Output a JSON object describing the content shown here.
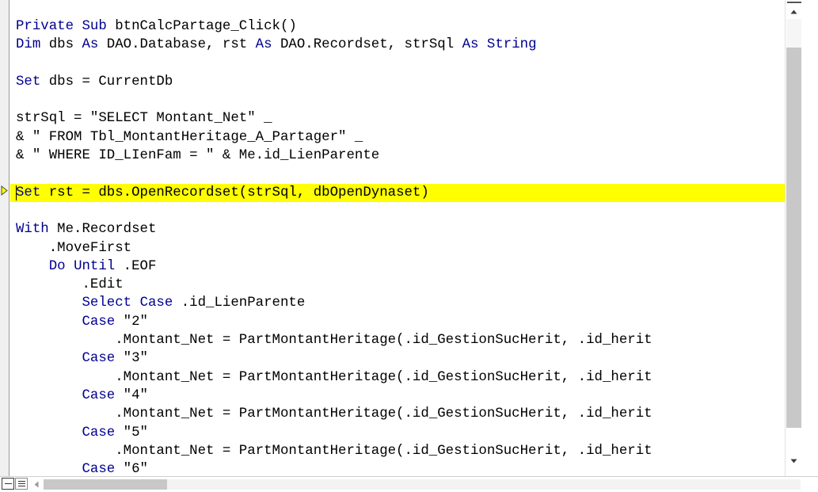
{
  "editor": {
    "name": "vba-code-editor",
    "language": "VBA",
    "colors": {
      "keyword": "#00008f",
      "identifier": "#000000",
      "background": "#ffffff",
      "highlight": "#ffff00",
      "margin": "#f0f0f0",
      "scrollbar_thumb": "#c8c8c8"
    },
    "next_statement_marker": "▷",
    "highlighted_line_index": 7,
    "caret_line_index": 7,
    "lines": [
      {
        "index": 0,
        "tokens": [
          {
            "t": "Private",
            "k": true
          },
          {
            "t": " ",
            "k": false
          },
          {
            "t": "Sub",
            "k": true
          },
          {
            "t": " btnCalcPartage_Click()",
            "k": false
          }
        ]
      },
      {
        "index": 1,
        "tokens": [
          {
            "t": "Dim",
            "k": true
          },
          {
            "t": " dbs ",
            "k": false
          },
          {
            "t": "As",
            "k": true
          },
          {
            "t": " DAO.Database, rst ",
            "k": false
          },
          {
            "t": "As",
            "k": true
          },
          {
            "t": " DAO.Recordset, strSql ",
            "k": false
          },
          {
            "t": "As",
            "k": true
          },
          {
            "t": " ",
            "k": false
          },
          {
            "t": "String",
            "k": true
          }
        ]
      },
      {
        "index": 2,
        "tokens": []
      },
      {
        "index": 3,
        "tokens": [
          {
            "t": "Set",
            "k": true
          },
          {
            "t": " dbs = CurrentDb",
            "k": false
          }
        ]
      },
      {
        "index": 4,
        "tokens": []
      },
      {
        "index": 5,
        "tokens": [
          {
            "t": "strSql = \"SELECT Montant_Net\" _",
            "k": false
          }
        ]
      },
      {
        "index": 6,
        "tokens": [
          {
            "t": "& \" FROM Tbl_MontantHeritage_A_Partager\" _",
            "k": false
          }
        ]
      },
      {
        "index": 7,
        "tokens": [
          {
            "t": "& \" WHERE ID_LIenFam = \" & Me.id_LienParente",
            "k": false
          }
        ]
      },
      {
        "index": 8,
        "tokens": []
      },
      {
        "index": 9,
        "highlight": true,
        "caret": true,
        "marker": true,
        "tokens": [
          {
            "t": "Set",
            "k": true
          },
          {
            "t": " rst = dbs.OpenRecordset(strSql, dbOpenDynaset)",
            "k": false
          }
        ]
      },
      {
        "index": 10,
        "tokens": []
      },
      {
        "index": 11,
        "tokens": [
          {
            "t": "With",
            "k": true
          },
          {
            "t": " Me.Recordset",
            "k": false
          }
        ]
      },
      {
        "index": 12,
        "tokens": [
          {
            "t": "    .MoveFirst",
            "k": false
          }
        ]
      },
      {
        "index": 13,
        "tokens": [
          {
            "t": "    ",
            "k": false
          },
          {
            "t": "Do",
            "k": true
          },
          {
            "t": " ",
            "k": false
          },
          {
            "t": "Until",
            "k": true
          },
          {
            "t": " .EOF",
            "k": false
          }
        ]
      },
      {
        "index": 14,
        "tokens": [
          {
            "t": "        .Edit",
            "k": false
          }
        ]
      },
      {
        "index": 15,
        "tokens": [
          {
            "t": "        ",
            "k": false
          },
          {
            "t": "Select",
            "k": true
          },
          {
            "t": " ",
            "k": false
          },
          {
            "t": "Case",
            "k": true
          },
          {
            "t": " .id_LienParente",
            "k": false
          }
        ]
      },
      {
        "index": 16,
        "tokens": [
          {
            "t": "        ",
            "k": false
          },
          {
            "t": "Case",
            "k": true
          },
          {
            "t": " \"2\"",
            "k": false
          }
        ]
      },
      {
        "index": 17,
        "tokens": [
          {
            "t": "            .Montant_Net = PartMontantHeritage(.id_GestionSucHerit, .id_herit",
            "k": false
          }
        ]
      },
      {
        "index": 18,
        "tokens": [
          {
            "t": "        ",
            "k": false
          },
          {
            "t": "Case",
            "k": true
          },
          {
            "t": " \"3\"",
            "k": false
          }
        ]
      },
      {
        "index": 19,
        "tokens": [
          {
            "t": "            .Montant_Net = PartMontantHeritage(.id_GestionSucHerit, .id_herit",
            "k": false
          }
        ]
      },
      {
        "index": 20,
        "tokens": [
          {
            "t": "        ",
            "k": false
          },
          {
            "t": "Case",
            "k": true
          },
          {
            "t": " \"4\"",
            "k": false
          }
        ]
      },
      {
        "index": 21,
        "tokens": [
          {
            "t": "            .Montant_Net = PartMontantHeritage(.id_GestionSucHerit, .id_herit",
            "k": false
          }
        ]
      },
      {
        "index": 22,
        "tokens": [
          {
            "t": "        ",
            "k": false
          },
          {
            "t": "Case",
            "k": true
          },
          {
            "t": " \"5\"",
            "k": false
          }
        ]
      },
      {
        "index": 23,
        "tokens": [
          {
            "t": "            .Montant_Net = PartMontantHeritage(.id_GestionSucHerit, .id_herit",
            "k": false
          }
        ]
      },
      {
        "index": 24,
        "tokens": [
          {
            "t": "        ",
            "k": false
          },
          {
            "t": "Case",
            "k": true
          },
          {
            "t": " \"6\"",
            "k": false
          }
        ]
      }
    ]
  },
  "scrollbars": {
    "vertical": {
      "up_arrow": "▲",
      "down_arrow": "▼",
      "thumb_top_pct": 10,
      "thumb_height_pct": 80
    },
    "horizontal": {
      "left_arrow": "◀",
      "thumb_left_pct": 0,
      "thumb_width_pct": 16
    }
  },
  "bottom_bar": {
    "procedure_view_label": "Procedure View",
    "full_module_view_label": "Full Module View"
  }
}
